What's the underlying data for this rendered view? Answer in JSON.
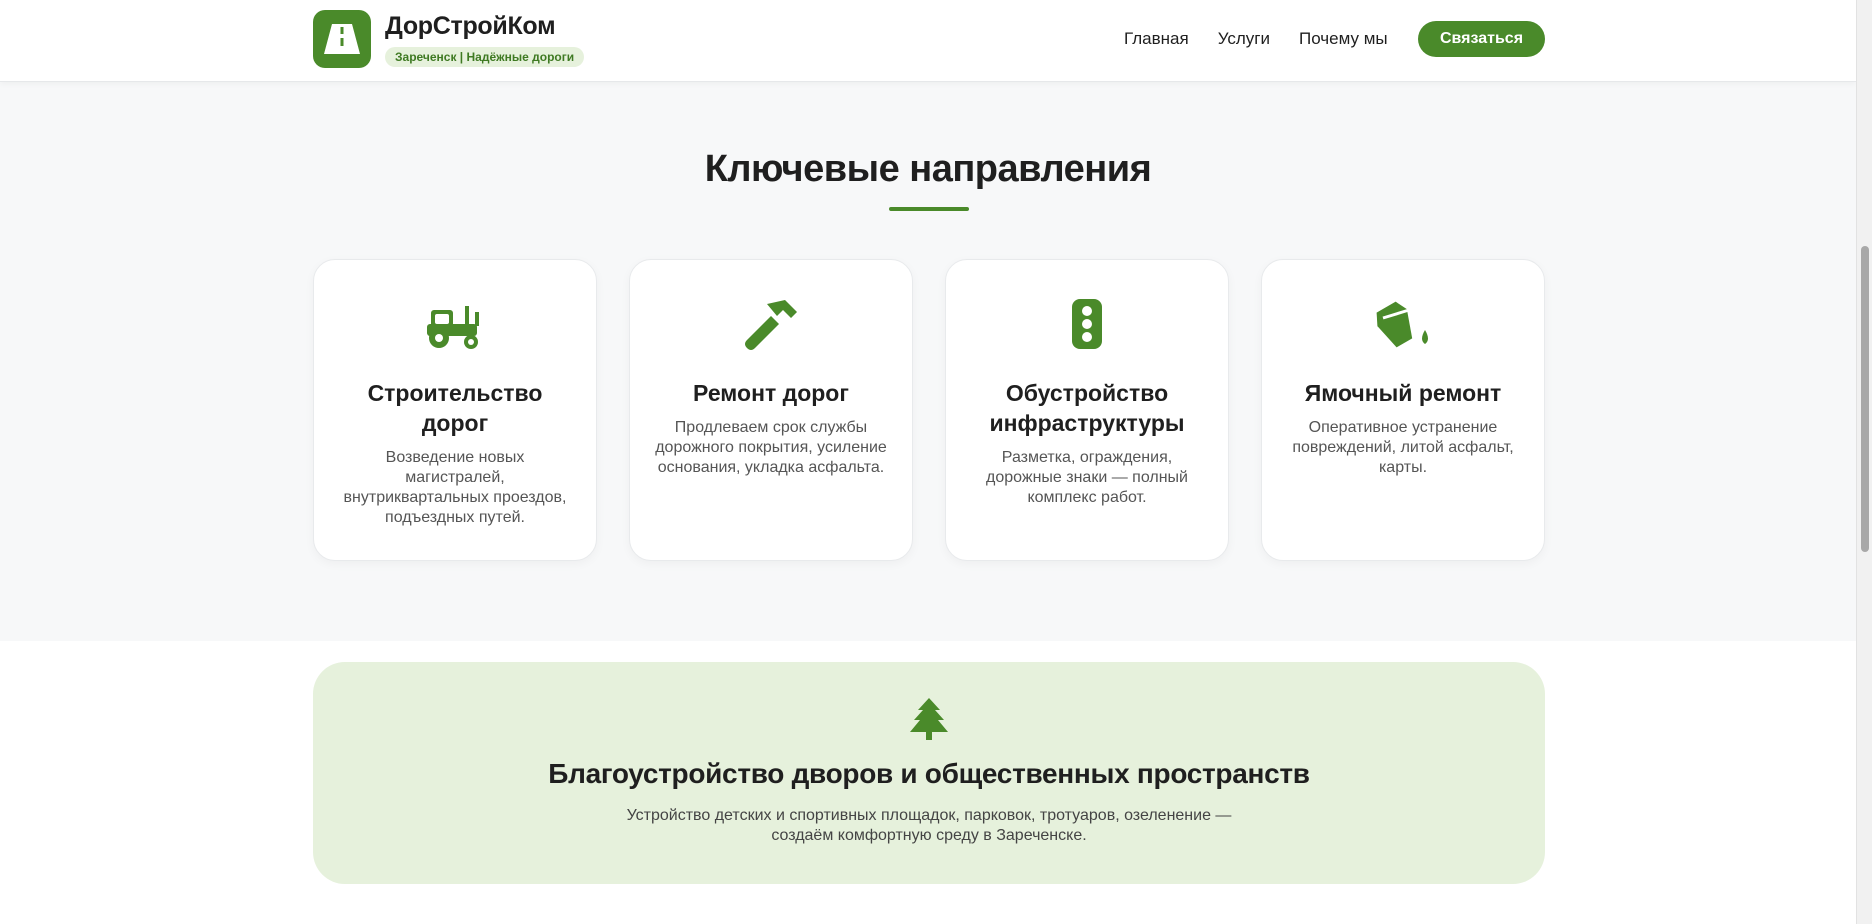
{
  "header": {
    "brand_name": "ДорСтройКом",
    "brand_badge": "Зареченск | Надёжные дороги",
    "nav": [
      "Главная",
      "Услуги",
      "Почему мы"
    ],
    "cta": "Связаться"
  },
  "section": {
    "title": "Ключевые направления"
  },
  "cards": [
    {
      "icon": "tractor-icon",
      "title": "Строительство дорог",
      "text": "Возведение новых магистралей, внутриквартальных проездов, подъездных путей."
    },
    {
      "icon": "hammer-icon",
      "title": "Ремонт дорог",
      "text": "Продлеваем срок службы дорожного покрытия, усиление основания, укладка асфальта."
    },
    {
      "icon": "traffic-light-icon",
      "title": "Обустройство инфраструктуры",
      "text": "Разметка, ограждения, дорожные знаки — полный комплекс работ."
    },
    {
      "icon": "paint-bucket-icon",
      "title": "Ямочный ремонт",
      "text": "Оперативное устранение повреждений, литой асфальт, карты."
    }
  ],
  "banner": {
    "icon": "tree-icon",
    "title": "Благоустройство дворов и общественных пространств",
    "text": "Устройство детских и спортивных площадок, парковок, тротуаров, озеленение — создаём комфортную среду в Зареченске."
  },
  "colors": {
    "accent": "#4a8a2a",
    "accent_light": "#e6f1dc",
    "background": "#f7f8f9"
  }
}
